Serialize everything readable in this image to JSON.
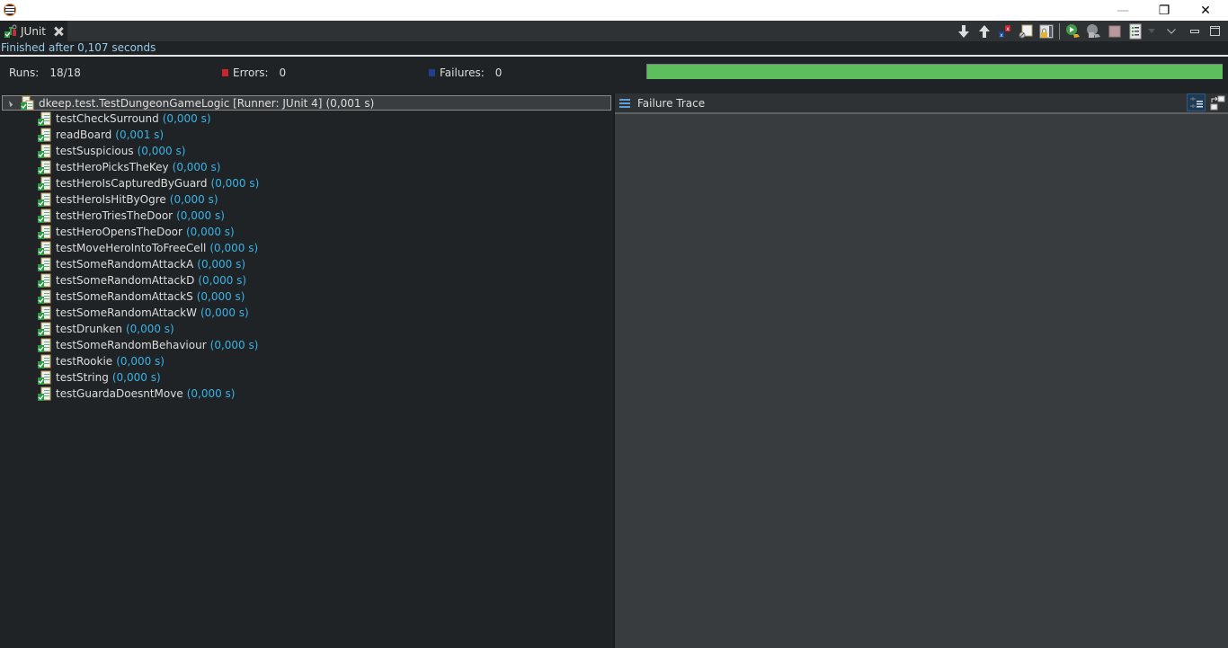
{
  "window": {
    "app_icon": "eclipse-icon",
    "controls": {
      "minimize": "—",
      "restore": "❐",
      "close": "✕"
    }
  },
  "view_tab": {
    "label": "JUnit",
    "icon": "junit-icon",
    "close_icon": "close-icon"
  },
  "toolbar": {
    "items": [
      {
        "name": "next-failure-button",
        "icon": "arrow-down-icon"
      },
      {
        "name": "previous-failure-button",
        "icon": "arrow-up-icon"
      },
      {
        "name": "show-failures-only-button",
        "icon": "failures-filter-icon"
      },
      {
        "name": "show-skipped-tests-button",
        "icon": "skipped-filter-icon"
      },
      {
        "name": "scroll-lock-button",
        "icon": "scroll-lock-icon"
      },
      {
        "name": "rerun-test-button",
        "icon": "rerun-icon"
      },
      {
        "name": "rerun-failed-first-button",
        "icon": "rerun-failed-icon"
      },
      {
        "name": "stop-button",
        "icon": "stop-icon"
      },
      {
        "name": "test-run-history-button",
        "icon": "history-icon"
      },
      {
        "name": "history-dropdown-button",
        "icon": "dropdown-arrow-icon"
      },
      {
        "name": "view-menu-button",
        "icon": "chevron-down-icon"
      },
      {
        "name": "minimize-view-button",
        "icon": "minimize-icon"
      },
      {
        "name": "maximize-view-button",
        "icon": "maximize-icon"
      }
    ]
  },
  "status": {
    "message": "Finished after 0,107 seconds"
  },
  "counters": {
    "runs_label": "Runs:",
    "runs_value": "18/18",
    "errors_label": "Errors:",
    "errors_value": "0",
    "failures_label": "Failures:",
    "failures_value": "0"
  },
  "progress": {
    "percent": 100,
    "color": "#5abf5c",
    "state": "success"
  },
  "tree": {
    "root": {
      "name": "dkeep.test.TestDungeonGameLogic [Runner: JUnit 4]",
      "time": "(0,001 s)",
      "expanded": true
    },
    "tests": [
      {
        "name": "testCheckSurround",
        "time": "(0,000 s)"
      },
      {
        "name": "readBoard",
        "time": "(0,001 s)"
      },
      {
        "name": "testSuspicious",
        "time": "(0,000 s)"
      },
      {
        "name": "testHeroPicksTheKey",
        "time": "(0,000 s)"
      },
      {
        "name": "testHeroIsCapturedByGuard",
        "time": "(0,000 s)"
      },
      {
        "name": "testHeroIsHitByOgre",
        "time": "(0,000 s)"
      },
      {
        "name": "testHeroTriesTheDoor",
        "time": "(0,000 s)"
      },
      {
        "name": "testHeroOpensTheDoor",
        "time": "(0,000 s)"
      },
      {
        "name": "testMoveHeroIntoToFreeCell",
        "time": "(0,000 s)"
      },
      {
        "name": "testSomeRandomAttackA",
        "time": "(0,000 s)"
      },
      {
        "name": "testSomeRandomAttackD",
        "time": "(0,000 s)"
      },
      {
        "name": "testSomeRandomAttackS",
        "time": "(0,000 s)"
      },
      {
        "name": "testSomeRandomAttackW",
        "time": "(0,000 s)"
      },
      {
        "name": "testDrunken",
        "time": "(0,000 s)"
      },
      {
        "name": "testSomeRandomBehaviour",
        "time": "(0,000 s)"
      },
      {
        "name": "testRookie",
        "time": "(0,000 s)"
      },
      {
        "name": "testString",
        "time": "(0,000 s)"
      },
      {
        "name": "testGuardaDoesntMove",
        "time": "(0,000 s)"
      }
    ]
  },
  "failure_trace": {
    "title": "Failure Trace",
    "buttons": [
      {
        "name": "filter-stack-trace-button",
        "icon": "filter-trace-icon",
        "active": true
      },
      {
        "name": "compare-results-button",
        "icon": "compare-icon",
        "active": false
      }
    ]
  }
}
